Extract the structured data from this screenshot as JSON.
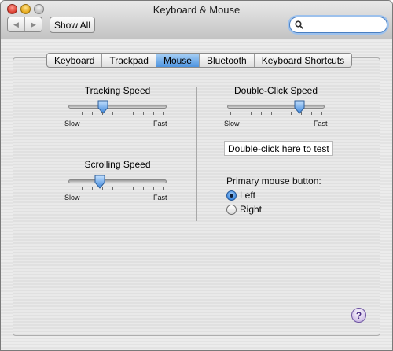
{
  "window": {
    "title": "Keyboard & Mouse"
  },
  "toolbar": {
    "back_icon": "left-arrow-icon",
    "forward_icon": "right-arrow-icon",
    "show_all_label": "Show All",
    "search_placeholder": ""
  },
  "tabs": [
    {
      "label": "Keyboard",
      "active": false
    },
    {
      "label": "Trackpad",
      "active": false
    },
    {
      "label": "Mouse",
      "active": true
    },
    {
      "label": "Bluetooth",
      "active": false
    },
    {
      "label": "Keyboard Shortcuts",
      "active": false
    }
  ],
  "tracking": {
    "title": "Tracking Speed",
    "min_label": "Slow",
    "max_label": "Fast",
    "value": 0.33
  },
  "scrolling": {
    "title": "Scrolling Speed",
    "min_label": "Slow",
    "max_label": "Fast",
    "value": 0.3
  },
  "double_click": {
    "title": "Double-Click Speed",
    "min_label": "Slow",
    "max_label": "Fast",
    "value": 0.77,
    "test_label": "Double-click here to test"
  },
  "primary_button": {
    "title": "Primary mouse button:",
    "options": [
      {
        "label": "Left",
        "selected": true
      },
      {
        "label": "Right",
        "selected": false
      }
    ]
  },
  "help": {
    "label": "?"
  },
  "colors": {
    "accent": "#4e94e0",
    "focus_ring": "#9dc1ec"
  }
}
